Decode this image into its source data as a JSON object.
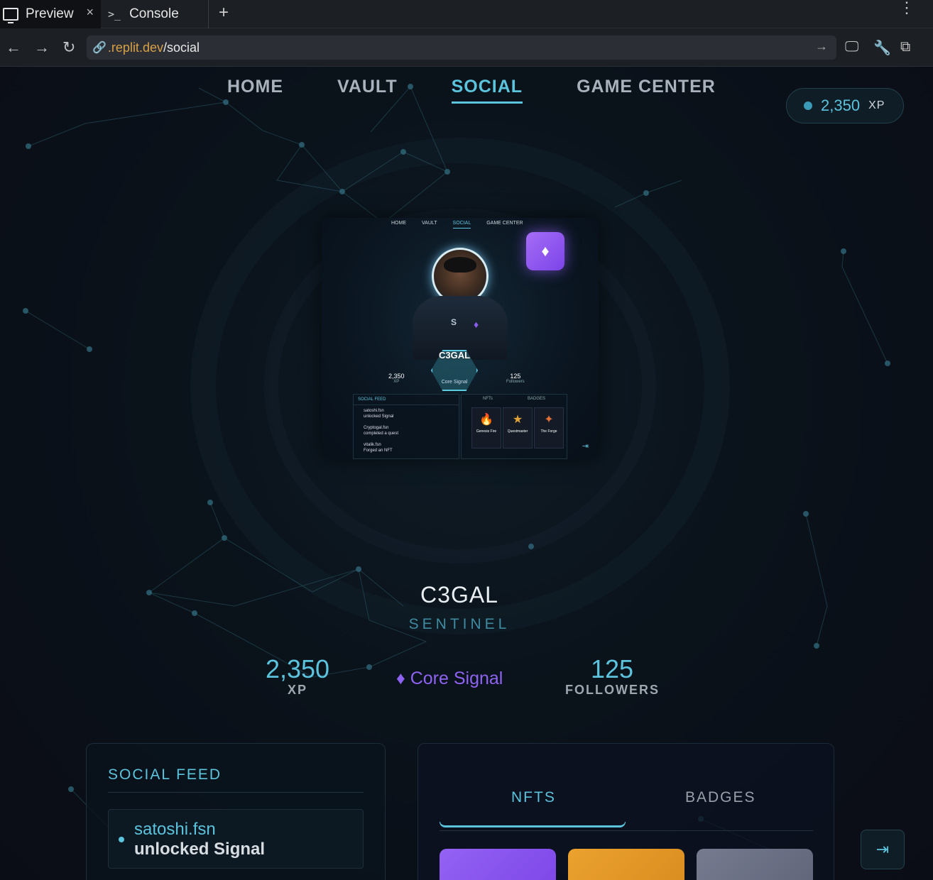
{
  "browser": {
    "tabs": [
      {
        "label": "Preview",
        "close": "×"
      },
      {
        "label": "Console",
        "prompt": ">_"
      }
    ],
    "new_tab": "+",
    "menu": "⋮",
    "url": {
      "domain": ".replit.dev",
      "path": "/social"
    }
  },
  "nav": {
    "items": [
      "HOME",
      "VAULT",
      "SOCIAL",
      "GAME CENTER"
    ],
    "active": "SOCIAL"
  },
  "xp_badge": {
    "value": "2,350",
    "unit": "XP"
  },
  "preview_card": {
    "nav": [
      "HOME",
      "VAULT",
      "SOCIAL",
      "GAME CENTER"
    ],
    "gem": "♦",
    "hex_title": "C3GAL",
    "hex_sub": "Core Signal",
    "xp": {
      "value": "2,350",
      "label": "XP"
    },
    "followers": {
      "value": "125",
      "label": "Followers"
    },
    "feed_title": "SOCIAL FEED",
    "feed": [
      {
        "user": "satoshi.fsn",
        "action": "unlocked Signal"
      },
      {
        "user": "Cryptogal.fsn",
        "action": "completed a quest"
      },
      {
        "user": "vitalik.fsn",
        "action": "Forged an NFT"
      }
    ],
    "tabs": [
      "NFTs",
      "BADGES"
    ],
    "tiles": [
      {
        "name": "Genesis Fire",
        "icon": "🔥"
      },
      {
        "name": "Questmaster",
        "icon": "★"
      },
      {
        "name": "The Forge",
        "icon": "✦"
      }
    ]
  },
  "profile": {
    "name": "C3GAL",
    "rank": "SENTINEL",
    "xp": {
      "value": "2,350",
      "label": "XP"
    },
    "signal": "♦ Core Signal",
    "followers": {
      "value": "125",
      "label": "FOLLOWERS"
    }
  },
  "feed": {
    "title": "SOCIAL FEED",
    "items": [
      {
        "user": "satoshi.fsn",
        "action": "unlocked Signal"
      }
    ]
  },
  "collection": {
    "tabs": [
      "NFTS",
      "BADGES"
    ],
    "active_tab": "NFTS",
    "card_colors": [
      "#8b55f0",
      "#e2992a",
      "#6f7488"
    ]
  },
  "colors": {
    "accent": "#5cc3dd",
    "purple": "#8e63f2"
  }
}
